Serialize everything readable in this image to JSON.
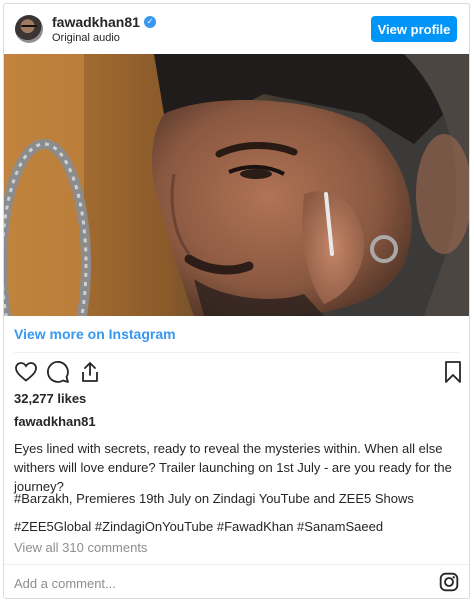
{
  "header": {
    "username": "fawadkhan81",
    "verified_icon": "verified-badge-icon",
    "subtitle": "Original audio",
    "view_profile_label": "View profile"
  },
  "media": {
    "description_icon": "video-still"
  },
  "view_more_label": "View more on Instagram",
  "actions": {
    "like_icon": "heart-icon",
    "comment_icon": "comment-icon",
    "share_icon": "share-icon",
    "save_icon": "bookmark-icon"
  },
  "likes": "32,277 likes",
  "owner": "fawadkhan81",
  "caption": {
    "line1": "Eyes lined with secrets, ready to reveal the mysteries within. When all else withers will love endure? Trailer launching on 1st July - are you ready for the journey?",
    "line2": "#Barzakh, Premieres 19th July on Zindagi YouTube and ZEE5 Shows",
    "line3": "#ZEE5Global #ZindagiOnYouTube #FawadKhan #SanamSaeed"
  },
  "comments_link": "View all 310 comments",
  "add_comment_placeholder": "Add a comment...",
  "footer_icon": "instagram-icon",
  "colors": {
    "accent": "#0095f6",
    "link": "#3897f0",
    "muted": "#8e8e8e",
    "border": "#dbdbdb"
  }
}
